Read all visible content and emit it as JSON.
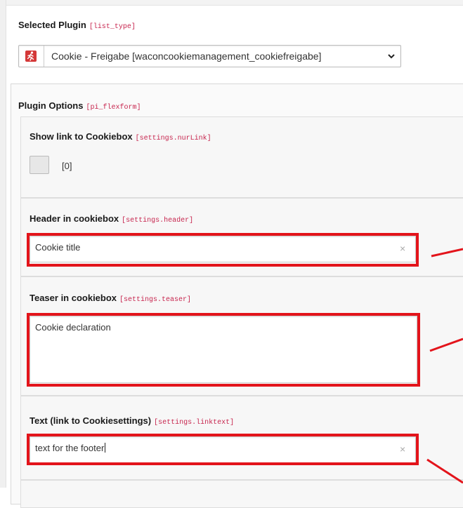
{
  "selected_plugin": {
    "label": "Selected Plugin",
    "field": "[list_type]",
    "value": "Cookie - Freigabe [waconcookiemanagement_cookiefreigabe]",
    "icon": "plugin-run-icon"
  },
  "plugin_options": {
    "label": "Plugin Options",
    "field": "[pi_flexform]",
    "show_link": {
      "label": "Show link to Cookiebox",
      "field": "[settings.nurLink]",
      "value": "[0]"
    },
    "header": {
      "label": "Header in cookiebox",
      "field": "[settings.header]",
      "value": "Cookie title"
    },
    "teaser": {
      "label": "Teaser in cookiebox",
      "field": "[settings.teaser]",
      "value": "Cookie declaration"
    },
    "linktext": {
      "label": "Text (link to Cookiesettings)",
      "field": "[settings.linktext]",
      "value": "text for the footer"
    }
  },
  "clear_glyph": "×",
  "colors": {
    "highlight": "#e3141b",
    "field_code": "#c7254e",
    "plugin_icon": "#d43838"
  }
}
